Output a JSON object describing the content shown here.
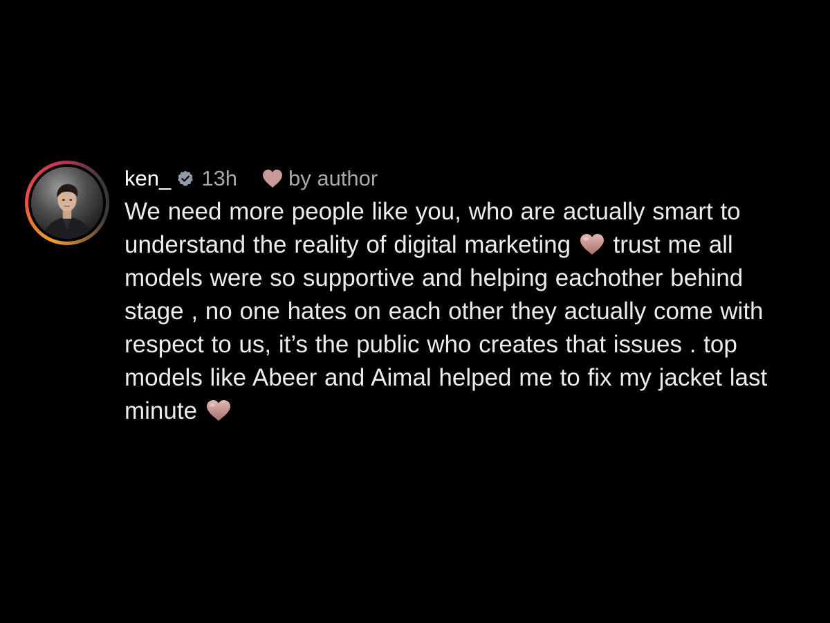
{
  "comment": {
    "username": "ken_",
    "verified": true,
    "time": "13h",
    "liked_by_author_label": "by author",
    "text_part_1": "We need more people like you, who are actually smart to understand the reality of digital marketing",
    "text_part_2": " trust me all models were so supportive and helping eachother behind stage , no one hates on each other they actually come with respect to us, it’s the public who creates that issues . top models like Abeer and Aimal helped me to fix my jacket last minute ",
    "icons": {
      "verified": "verified-badge-icon",
      "liked": "heart-icon",
      "emoji": "brown-heart-emoji"
    },
    "colors": {
      "heart": "#c99a98",
      "verified_badge": "#8e9aa8",
      "secondary_text": "#a8a8a8",
      "avatar_ring": "#f0a032"
    }
  }
}
